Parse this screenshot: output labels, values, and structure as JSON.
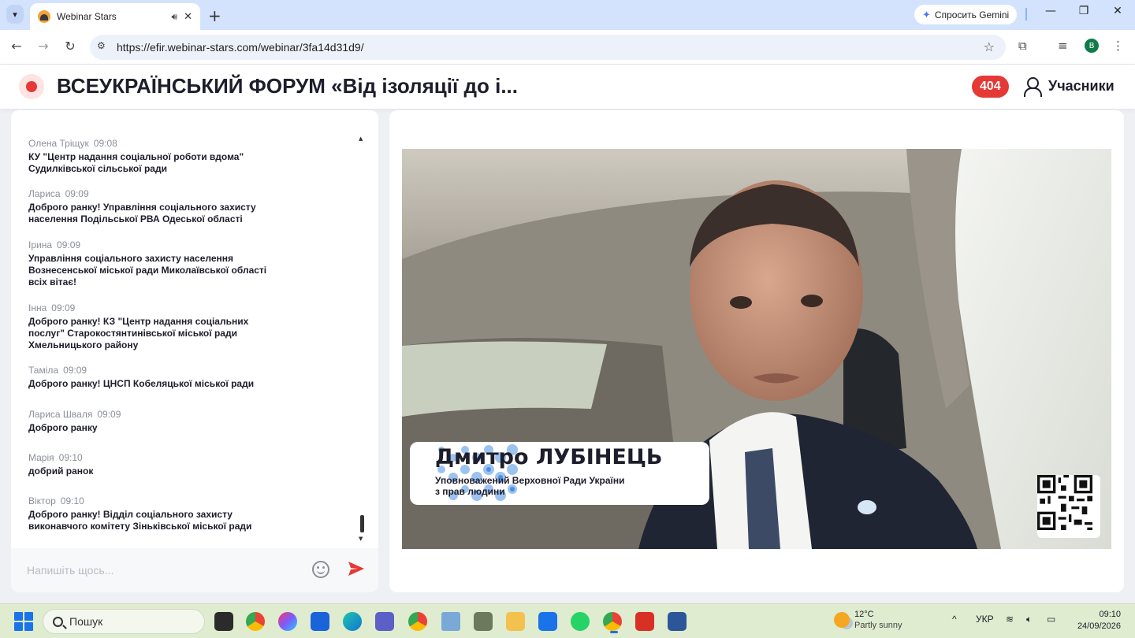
{
  "browser": {
    "tab_title": "Webinar Stars",
    "url": "https://efir.webinar-stars.com/webinar/3fa14d31d9/",
    "gemini_label": "Спросить Gemini",
    "profile_initial": "B"
  },
  "header": {
    "title": "ВСЕУКРАЇНСЬКИЙ ФОРУМ «Від ізоляції до і...",
    "participants_count": "404",
    "participants_label": "Учасники"
  },
  "chat": {
    "messages": [
      {
        "author": "Олена Тріщук",
        "time": "09:08",
        "text": "КУ \"Центр надання соціальної роботи вдома\"\nСудилківської сільської ради"
      },
      {
        "author": "Лариса",
        "time": "09:09",
        "text": "Доброго ранку! Управління соціального захисту\nнаселення Подільської РВА Одеської області"
      },
      {
        "author": "Ірина",
        "time": "09:09",
        "text": "Управління соціального захисту населення\nВознесенської міської ради Миколаївської області\nвсіх вітає!"
      },
      {
        "author": "Інна",
        "time": "09:09",
        "text": "Доброго ранку! КЗ \"Центр надання соціальних\nпослуг\" Старокостянтинівської міської ради\nХмельницького району"
      },
      {
        "author": "Таміла",
        "time": "09:09",
        "text": "Доброго ранку! ЦНСП Кобеляцької міської ради"
      },
      {
        "author": "Лариса Шваля",
        "time": "09:09",
        "text": "Доброго ранку"
      },
      {
        "author": "Марія",
        "time": "09:10",
        "text": "добрий ранок"
      },
      {
        "author": "Віктор",
        "time": "09:10",
        "text": "Доброго ранку! Відділ соціального захисту\nвиконавчого комітету Зіньківської міської ради"
      }
    ],
    "input_placeholder": "Напишіть щось..."
  },
  "video": {
    "speaker_name": "Дмитро ЛУБІНЕЦЬ",
    "speaker_role": "Уповноважений Верховної Ради України\nз прав людини"
  },
  "taskbar": {
    "search_label": "Пошук",
    "weather_temp": "12°C",
    "weather_desc": "Partly sunny",
    "language": "УКР",
    "time": "09:10",
    "date": "24/09/2026"
  },
  "colors": {
    "accent_red": "#e53935",
    "browser_tab_bg": "#d3e3fd",
    "taskbar_bg": "#dfeccf"
  }
}
